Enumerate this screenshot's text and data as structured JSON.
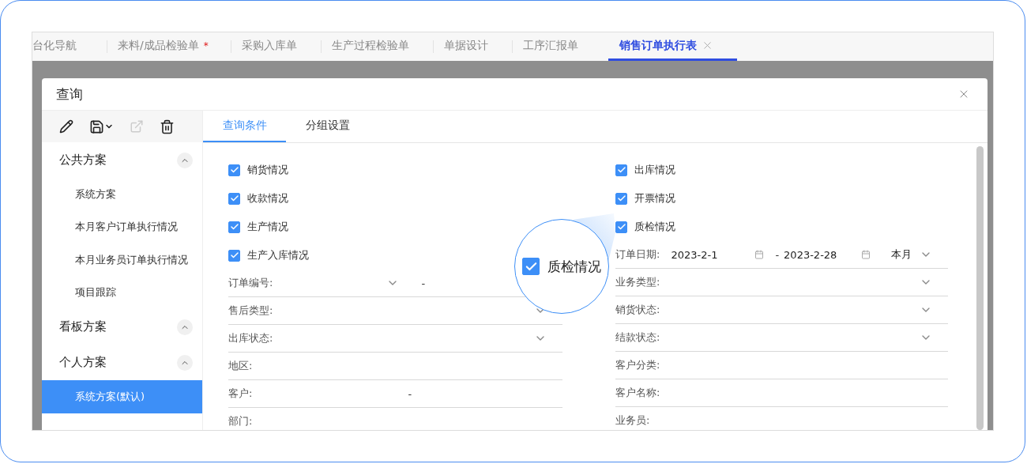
{
  "tabs": [
    {
      "label": "台化导航",
      "selected": false
    },
    {
      "label": "来料/成品检验单",
      "selected": false,
      "marker": "*"
    },
    {
      "label": "采购入库单",
      "selected": false
    },
    {
      "label": "生产过程检验单",
      "selected": false
    },
    {
      "label": "单据设计",
      "selected": false
    },
    {
      "label": "工序汇报单",
      "selected": false
    },
    {
      "label": "销售订单执行表",
      "selected": true,
      "closable": true
    }
  ],
  "dialog": {
    "title": "查询",
    "sidebar": {
      "groups": [
        {
          "label": "公共方案",
          "expanded": true,
          "items": [
            {
              "label": "系统方案",
              "selected": false
            },
            {
              "label": "本月客户订单执行情况",
              "selected": false
            },
            {
              "label": "本月业务员订单执行情况",
              "selected": false
            },
            {
              "label": "项目跟踪",
              "selected": false
            }
          ]
        },
        {
          "label": "看板方案",
          "expanded": true
        },
        {
          "label": "个人方案",
          "expanded": true,
          "items": [
            {
              "label": "系统方案(默认)",
              "selected": true
            }
          ]
        }
      ]
    },
    "tabs": [
      {
        "label": "查询条件",
        "selected": true
      },
      {
        "label": "分组设置",
        "selected": false
      }
    ],
    "left_column": [
      {
        "kind": "checkbox",
        "label": "销货情况",
        "checked": true
      },
      {
        "kind": "checkbox",
        "label": "收款情况",
        "checked": true
      },
      {
        "kind": "checkbox",
        "label": "生产情况",
        "checked": true
      },
      {
        "kind": "checkbox",
        "label": "生产入库情况",
        "checked": true
      },
      {
        "kind": "select_range",
        "label": "订单编号:",
        "separator": "-"
      },
      {
        "kind": "select",
        "label": "售后类型:"
      },
      {
        "kind": "select",
        "label": "出库状态:"
      },
      {
        "kind": "text",
        "label": "地区:"
      },
      {
        "kind": "range",
        "label": "客户:",
        "separator": "-"
      },
      {
        "kind": "text",
        "label": "部门:"
      }
    ],
    "right_column": [
      {
        "kind": "checkbox",
        "label": "出库情况",
        "checked": true
      },
      {
        "kind": "checkbox",
        "label": "开票情况",
        "checked": true
      },
      {
        "kind": "checkbox",
        "label": "质检情况",
        "checked": true
      },
      {
        "kind": "date_range",
        "label": "订单日期:",
        "from": "2023-2-1",
        "separator": "-",
        "to": "2023-2-28",
        "period": "本月"
      },
      {
        "kind": "select",
        "label": "业务类型:"
      },
      {
        "kind": "select",
        "label": "销货状态:"
      },
      {
        "kind": "select",
        "label": "结款状态:"
      },
      {
        "kind": "text",
        "label": "客户分类:"
      },
      {
        "kind": "text",
        "label": "客户名称:"
      },
      {
        "kind": "text",
        "label": "业务员:"
      }
    ],
    "magnifier": {
      "label": "质检情况",
      "checked": true
    }
  }
}
